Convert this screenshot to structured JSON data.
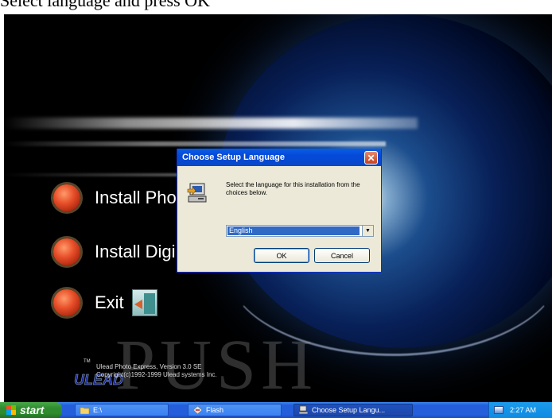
{
  "caption": {
    "text": "Select language and press OK"
  },
  "splash": {
    "menu": [
      {
        "label": "Install Pho"
      },
      {
        "label": "Install Digi"
      },
      {
        "label": "Exit"
      }
    ],
    "brand_watermark": "PUSH",
    "logo": "ULEAD",
    "logo_tm": "TM",
    "version_lines": [
      "Ulead Photo Express, Version 3.0 SE",
      "Copyright(c)1992-1999 Ulead systems Inc."
    ]
  },
  "dialog": {
    "title": "Choose Setup Language",
    "close_glyph": "✕",
    "message": "Select the language for this installation from the choices below.",
    "language_select": {
      "selected": "English",
      "arrow_glyph": "▼"
    },
    "ok_label": "OK",
    "cancel_label": "Cancel"
  },
  "taskbar": {
    "start_label": "start",
    "tasks": [
      {
        "label": "E:\\",
        "icon": "folder-icon"
      },
      {
        "label": "Flash",
        "icon": "flash-icon"
      },
      {
        "label": "Choose Setup Langu...",
        "icon": "setup-icon",
        "active": true
      }
    ],
    "clock": "2:27 AM",
    "tray_icon": "network-icon"
  },
  "colors": {
    "dialog_title_bar": "#0a5ee6",
    "taskbar": "#245edb",
    "start_button": "#2e8b2e",
    "menu_dot": "#e8502a"
  }
}
